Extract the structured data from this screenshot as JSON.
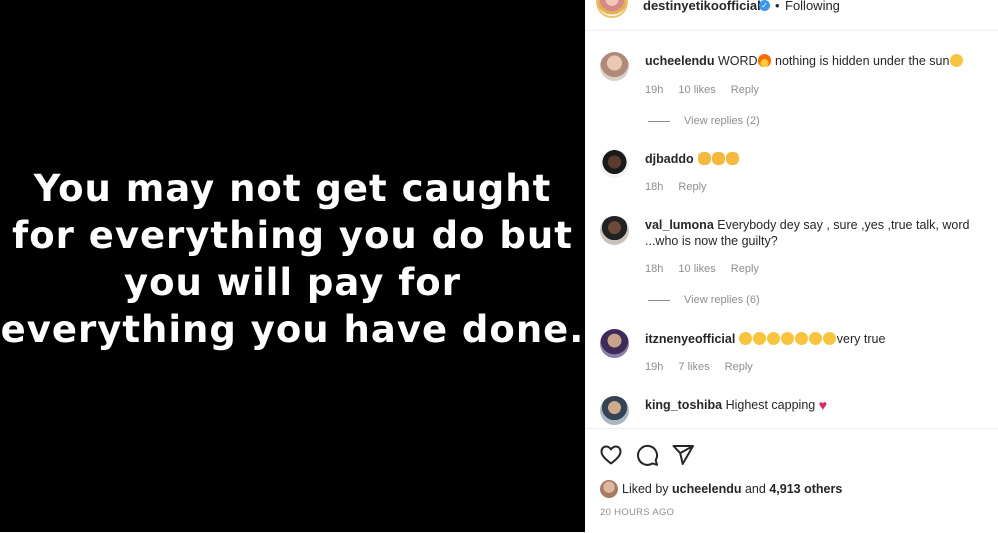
{
  "post": {
    "text": "You may not get caught\nfor everything you do but\nyou will pay for\neverything you have done."
  },
  "header": {
    "username": "destinyetikoofficial",
    "separator": "•",
    "follow_status": "Following"
  },
  "comments": [
    {
      "username": "ucheelendu",
      "text": "WORD",
      "emoji_1": "fire-emoji",
      "text_2": " nothing is hidden under the sun",
      "emoji_2": "face-screaming-emoji",
      "time": "19h",
      "likes": "10 likes",
      "reply": "Reply",
      "view_replies": "View replies (2)"
    },
    {
      "username": "djbaddo",
      "text": "",
      "emoji": "ok-hand-emoji x3",
      "time": "18h",
      "reply": "Reply"
    },
    {
      "username": "val_lumona",
      "text": "Everybody dey say , sure ,yes ,true talk, word ...who is now the guilty?",
      "time": "18h",
      "likes": "10 likes",
      "reply": "Reply",
      "view_replies": "View replies (6)"
    },
    {
      "username": "itznenyeofficial",
      "emoji": "face-screaming-emoji x7",
      "text": "very true",
      "time": "19h",
      "likes": "7 likes",
      "reply": "Reply"
    },
    {
      "username": "king_toshiba",
      "text": "Highest capping",
      "emoji": "red-heart-emoji"
    }
  ],
  "actions": {
    "liked_by_prefix": "Liked by ",
    "liked_by_user": "ucheelendu",
    "liked_by_mid": " and ",
    "liked_by_count": "4,913 others",
    "timestamp": "20 HOURS AGO"
  },
  "colors": {
    "verified": "#3897f0",
    "muted": "#8e8e8e",
    "heart": "#e0245e"
  },
  "icons": {
    "like": "heart-icon",
    "comment": "comment-bubble-icon",
    "share": "send-paper-plane-icon",
    "verified": "verified-badge-icon"
  }
}
